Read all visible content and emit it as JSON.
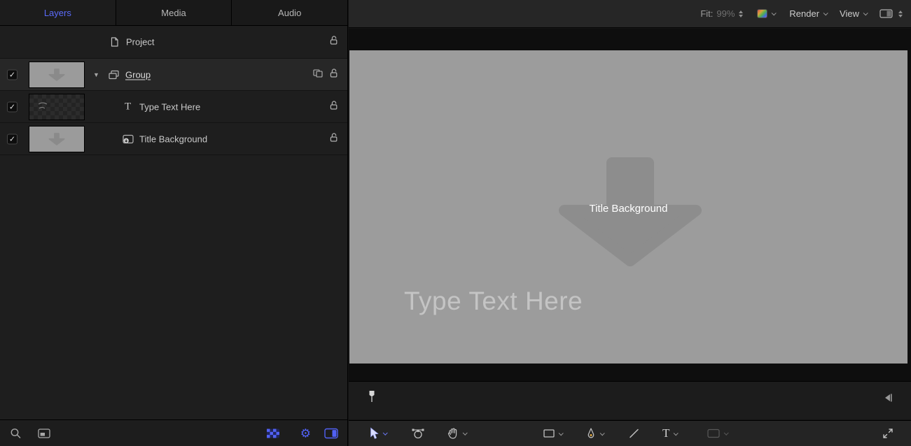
{
  "tabs": {
    "layers": "Layers",
    "media": "Media",
    "audio": "Audio"
  },
  "layers_panel": {
    "project": {
      "label": "Project"
    },
    "group": {
      "label": "Group"
    },
    "text_layer": {
      "label": "Type Text Here"
    },
    "background_layer": {
      "label": "Title Background"
    }
  },
  "viewer_toolbar": {
    "fit_label": "Fit:",
    "zoom_value": "99%",
    "render_label": "Render",
    "view_label": "View"
  },
  "canvas": {
    "background_title": "Title Background",
    "placeholder_text": "Type Text Here"
  },
  "glyphs": {
    "check": "✓",
    "disclosure_down": "▼",
    "gear": "⚙",
    "type_icon": "T",
    "text_tool": "T"
  },
  "colors": {
    "accent_blue": "#5161f5",
    "canvas_gray": "#9c9c9c",
    "canvas_arrow": "#8d8d8d",
    "panel_dark": "#1e1e1e"
  }
}
